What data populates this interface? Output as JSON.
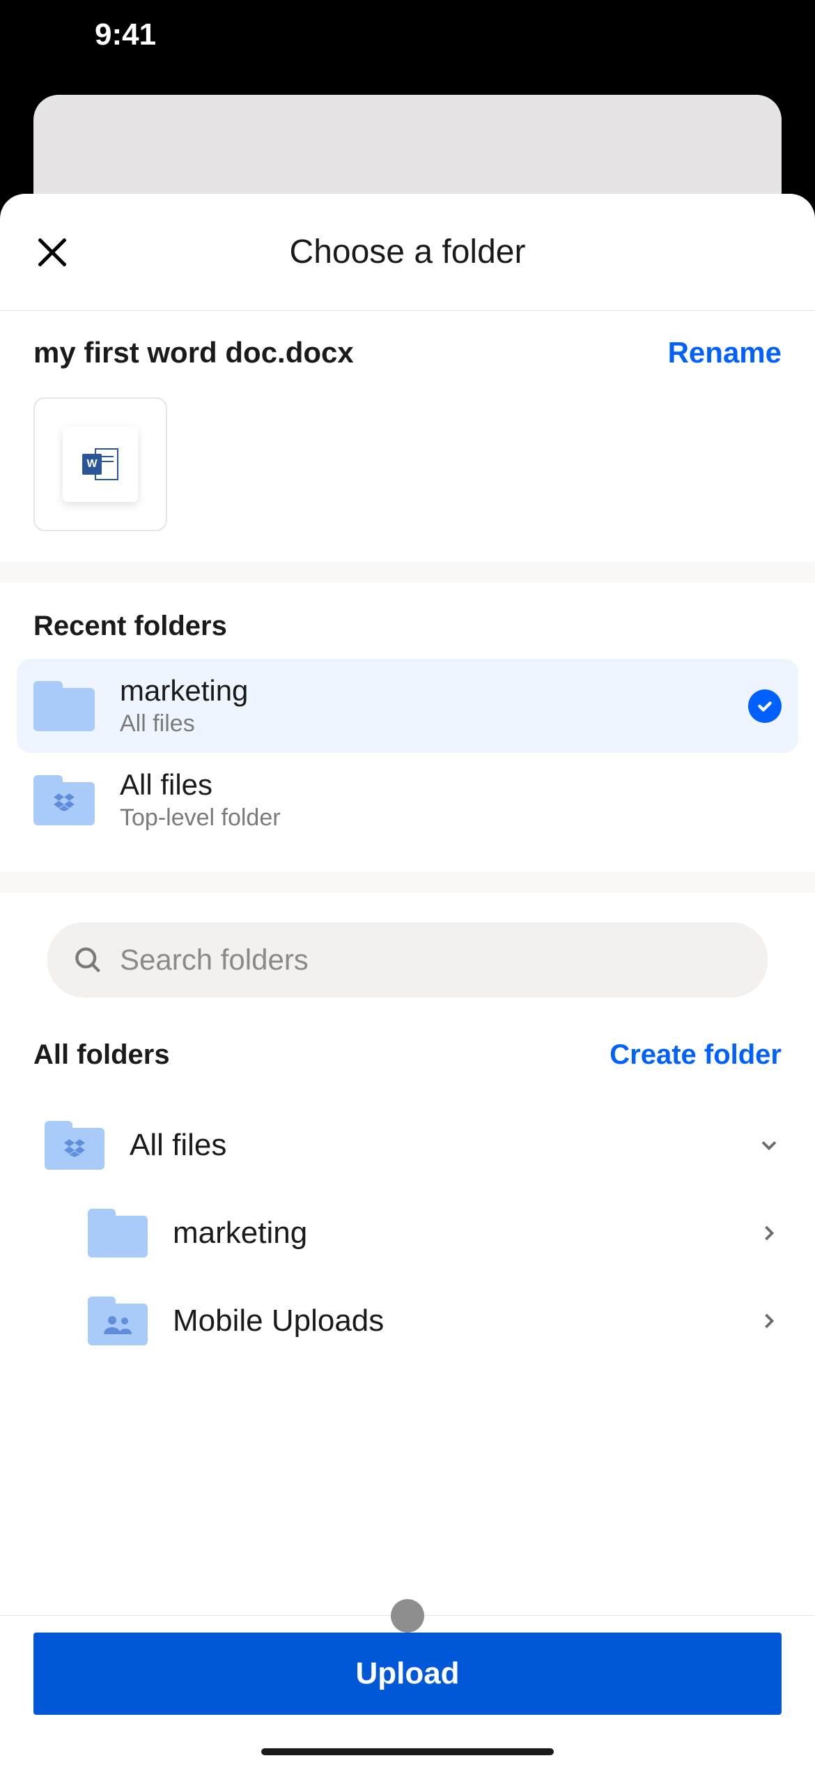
{
  "status": {
    "time": "9:41"
  },
  "modal": {
    "title": "Choose a folder",
    "file_name": "my first word doc.docx",
    "rename_label": "Rename",
    "word_badge": "W"
  },
  "recent": {
    "heading": "Recent folders",
    "items": [
      {
        "name": "marketing",
        "sub": "All files",
        "selected": true,
        "icon": "folder"
      },
      {
        "name": "All files",
        "sub": "Top-level folder",
        "selected": false,
        "icon": "folder-dropbox"
      }
    ]
  },
  "search": {
    "placeholder": "Search folders"
  },
  "all_folders": {
    "heading": "All folders",
    "create_label": "Create folder",
    "tree": [
      {
        "name": "All files",
        "icon": "folder-dropbox",
        "chevron": "down",
        "indent": false
      },
      {
        "name": "marketing",
        "icon": "folder",
        "chevron": "right",
        "indent": true
      },
      {
        "name": "Mobile Uploads",
        "icon": "folder-people",
        "chevron": "right",
        "indent": true
      }
    ]
  },
  "upload": {
    "label": "Upload"
  }
}
